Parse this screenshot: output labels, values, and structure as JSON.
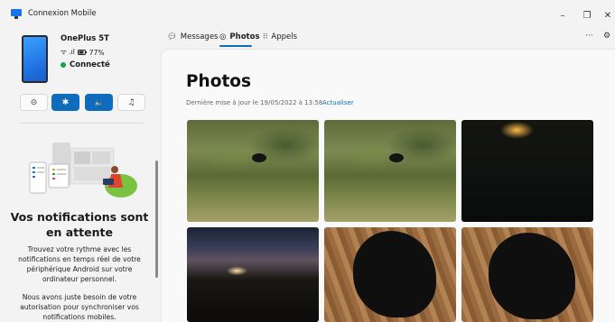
{
  "app": {
    "title": "Connexion Mobile"
  },
  "window": {
    "minimize": "–",
    "maximize": "❐",
    "close": "✕"
  },
  "device": {
    "name": "OnePlus 5T",
    "signal": "ᯤ .ıl",
    "battery_percent": "77%",
    "connection_status": "Connecté"
  },
  "quick_actions": [
    {
      "icon": "do-not-disturb-icon",
      "glyph": "⊝"
    },
    {
      "icon": "bluetooth-icon",
      "glyph": "✱"
    },
    {
      "icon": "volume-icon",
      "glyph": "🔈"
    },
    {
      "icon": "music-icon",
      "glyph": "♫"
    }
  ],
  "notifications": {
    "title_line1": "Vos notifications sont",
    "title_line2": "en attente",
    "p1_l1": "Trouvez votre rythme avec les",
    "p1_l2": "notifications en temps réel de votre",
    "p1_l3": "périphérique Android sur votre",
    "p1_l4": "ordinateur personnel.",
    "p2_l1": "Nous avons juste besoin de votre",
    "p2_l2": "autorisation pour synchroniser vos",
    "p2_l3": "notifications mobiles."
  },
  "tabs": [
    {
      "label": "Messages",
      "icon": "message-icon",
      "active": false
    },
    {
      "label": "Photos",
      "icon": "photo-icon",
      "active": true
    },
    {
      "label": "Appels",
      "icon": "dialpad-icon",
      "active": false
    }
  ],
  "toolbar": {
    "more": "···",
    "settings": "⚙"
  },
  "photos_page": {
    "title": "Photos",
    "last_update": "Dernière mise à jour le 19/05/2022 à 13:58",
    "refresh_label": "Actualiser"
  },
  "colors": {
    "accent": "#0f6cbd",
    "connected": "#16a34a"
  }
}
